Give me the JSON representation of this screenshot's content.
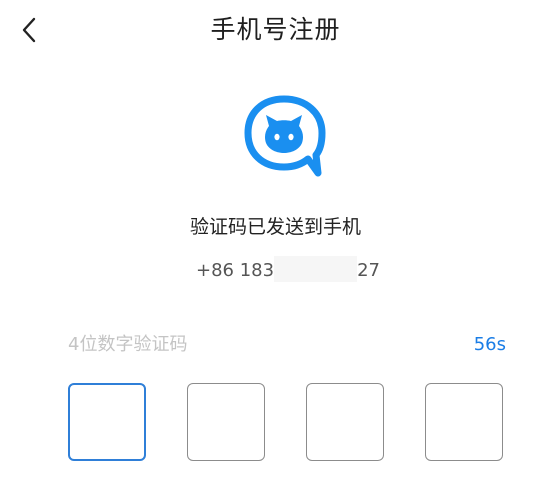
{
  "header": {
    "title": "手机号注册",
    "back_icon": "chevron-left-icon"
  },
  "logo": {
    "icon": "blue-cat-chat-bubble-logo",
    "color": "#1a8ff0"
  },
  "verification": {
    "message": "验证码已发送到手机",
    "phone_prefix": "+86 183",
    "phone_suffix": "27",
    "code_placeholder": "4位数字验证码",
    "countdown": "56s",
    "digits": [
      "",
      "",
      "",
      ""
    ]
  },
  "colors": {
    "accent": "#1a7de6",
    "active_box": "#2f7fd8",
    "hint": "#c4c4c4"
  }
}
